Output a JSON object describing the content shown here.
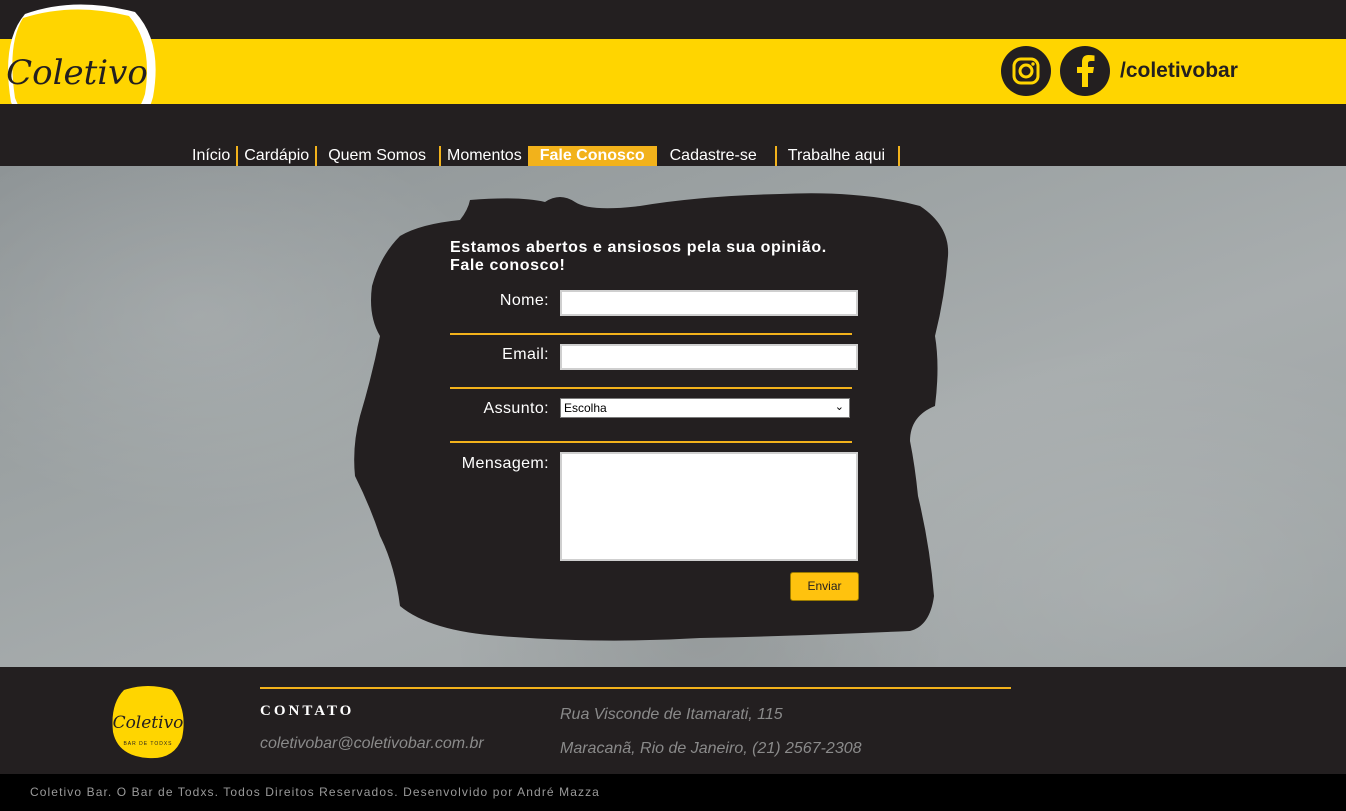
{
  "brand": {
    "logo_script": "Coletivo",
    "logo_tagline": "BAR DE TODXS",
    "colors": {
      "yellow": "#ffd500",
      "accent": "#f2b21b",
      "dark": "#231f20"
    }
  },
  "social": {
    "icons": [
      "instagram-icon",
      "facebook-icon"
    ],
    "handle": "/coletivobar"
  },
  "nav": {
    "items": [
      {
        "label": "Início",
        "active": false
      },
      {
        "label": "Cardápio",
        "active": false
      },
      {
        "label": "Quem Somos",
        "active": false
      },
      {
        "label": "Momentos",
        "active": false
      },
      {
        "label": "Fale Conosco",
        "active": true
      },
      {
        "label": "Cadastre-se",
        "active": false
      },
      {
        "label": "Trabalhe aqui",
        "active": false
      }
    ]
  },
  "form": {
    "title_line1": "Estamos abertos e ansiosos pela sua opinião.",
    "title_line2": "Fale conosco!",
    "name_label": "Nome:",
    "name_value": "",
    "email_label": "Email:",
    "email_value": "",
    "subject_label": "Assunto:",
    "subject_selected": "Escolha",
    "message_label": "Mensagem:",
    "message_value": "",
    "submit_label": "Enviar"
  },
  "footer": {
    "contact_title": "CONTATO",
    "email": "coletivobar@coletivobar.com.br",
    "address_line1": "Rua Visconde de Itamarati, 115",
    "address_line2": "Maracanã, Rio de Janeiro, (21) 2567-2308",
    "copyright": "Coletivo Bar. O Bar de Todxs. Todos Direitos Reservados. Desenvolvido por André Mazza"
  }
}
